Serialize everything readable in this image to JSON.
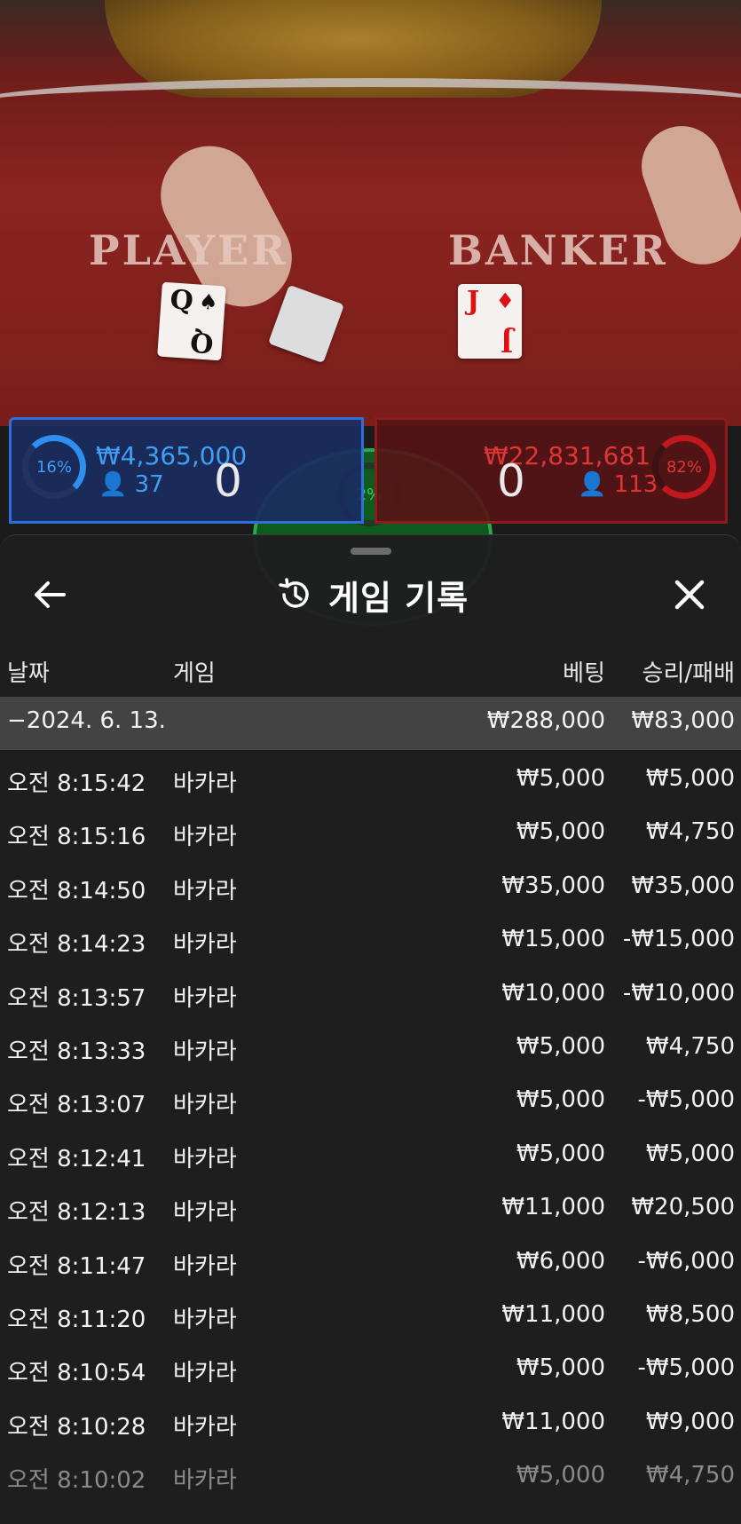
{
  "table": {
    "player_label": "PLAYER",
    "banker_label": "BANKER",
    "player_card": {
      "rank": "Q",
      "suit": "♠"
    },
    "banker_card": {
      "rank": "J",
      "suit": "♦"
    },
    "player_percent": "16%",
    "player_amount": "₩4,365,000",
    "player_count": "37",
    "player_score": "0",
    "tie_percent": "2%",
    "banker_amount": "₩22,831,681",
    "banker_count": "113",
    "banker_score": "0",
    "banker_percent": "82%",
    "colors": {
      "player": "#2f6fdc",
      "banker": "#c0181c",
      "tie": "#2fa84a"
    }
  },
  "sheet": {
    "title": "게임 기록",
    "back_icon": "arrow-left-icon",
    "history_icon": "history-icon",
    "close_icon": "close-icon",
    "columns": {
      "date": "날짜",
      "game": "게임",
      "bet": "베팅",
      "result": "승리/패배"
    },
    "date_row": {
      "date": "−2024. 6. 13.",
      "bet": "₩288,000",
      "result": "₩83,000"
    },
    "rows": [
      {
        "time": "오전 8:15:42",
        "game": "바카라",
        "bet": "₩5,000",
        "result": "₩5,000"
      },
      {
        "time": "오전 8:15:16",
        "game": "바카라",
        "bet": "₩5,000",
        "result": "₩4,750"
      },
      {
        "time": "오전 8:14:50",
        "game": "바카라",
        "bet": "₩35,000",
        "result": "₩35,000"
      },
      {
        "time": "오전 8:14:23",
        "game": "바카라",
        "bet": "₩15,000",
        "result": "-₩15,000"
      },
      {
        "time": "오전 8:13:57",
        "game": "바카라",
        "bet": "₩10,000",
        "result": "-₩10,000"
      },
      {
        "time": "오전 8:13:33",
        "game": "바카라",
        "bet": "₩5,000",
        "result": "₩4,750"
      },
      {
        "time": "오전 8:13:07",
        "game": "바카라",
        "bet": "₩5,000",
        "result": "-₩5,000"
      },
      {
        "time": "오전 8:12:41",
        "game": "바카라",
        "bet": "₩5,000",
        "result": "₩5,000"
      },
      {
        "time": "오전 8:12:13",
        "game": "바카라",
        "bet": "₩11,000",
        "result": "₩20,500"
      },
      {
        "time": "오전 8:11:47",
        "game": "바카라",
        "bet": "₩6,000",
        "result": "-₩6,000"
      },
      {
        "time": "오전 8:11:20",
        "game": "바카라",
        "bet": "₩11,000",
        "result": "₩8,500"
      },
      {
        "time": "오전 8:10:54",
        "game": "바카라",
        "bet": "₩5,000",
        "result": "-₩5,000"
      },
      {
        "time": "오전 8:10:28",
        "game": "바카라",
        "bet": "₩11,000",
        "result": "₩9,000"
      },
      {
        "time": "오전 8:10:02",
        "game": "바카라",
        "bet": "₩5,000",
        "result": "₩4,750"
      }
    ]
  }
}
